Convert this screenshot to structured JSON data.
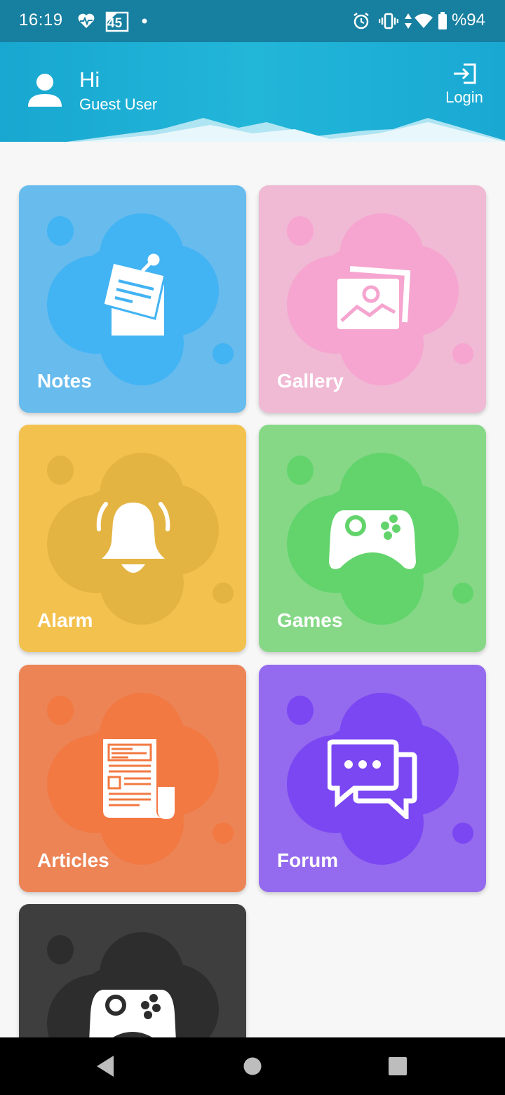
{
  "status_bar": {
    "time": "16:19",
    "badge_number": "45",
    "battery_text": "%94",
    "icons": [
      "heart-pulse-icon",
      "calendar-icon",
      "dot-icon",
      "alarm-icon",
      "vibrate-icon",
      "data-arrows-icon",
      "wifi-icon",
      "battery-icon"
    ]
  },
  "header": {
    "greeting": "Hi",
    "user_name": "Guest User",
    "login_label": "Login",
    "background_color": "#1aaed6"
  },
  "tiles": [
    {
      "label": "Notes",
      "icon": "notes-icon",
      "bg": "#67bbed",
      "blob": "#42b3f3"
    },
    {
      "label": "Gallery",
      "icon": "gallery-icon",
      "bg": "#f0b9d4",
      "blob": "#f5a5cf"
    },
    {
      "label": "Alarm",
      "icon": "bell-icon",
      "bg": "#f3c14e",
      "blob": "#e4b443"
    },
    {
      "label": "Games",
      "icon": "gamepad-icon",
      "bg": "#86d887",
      "blob": "#63d46c"
    },
    {
      "label": "Articles",
      "icon": "newspaper-icon",
      "bg": "#ec8456",
      "blob": "#f27942"
    },
    {
      "label": "Forum",
      "icon": "chat-icon",
      "bg": "#946bee",
      "blob": "#7a47f2"
    },
    {
      "label": "",
      "icon": "gamepad-icon",
      "bg": "#3e3e3e",
      "blob": "#2d2d2d"
    }
  ],
  "nav": {
    "icons": [
      "back-icon",
      "home-icon",
      "recents-icon"
    ]
  }
}
